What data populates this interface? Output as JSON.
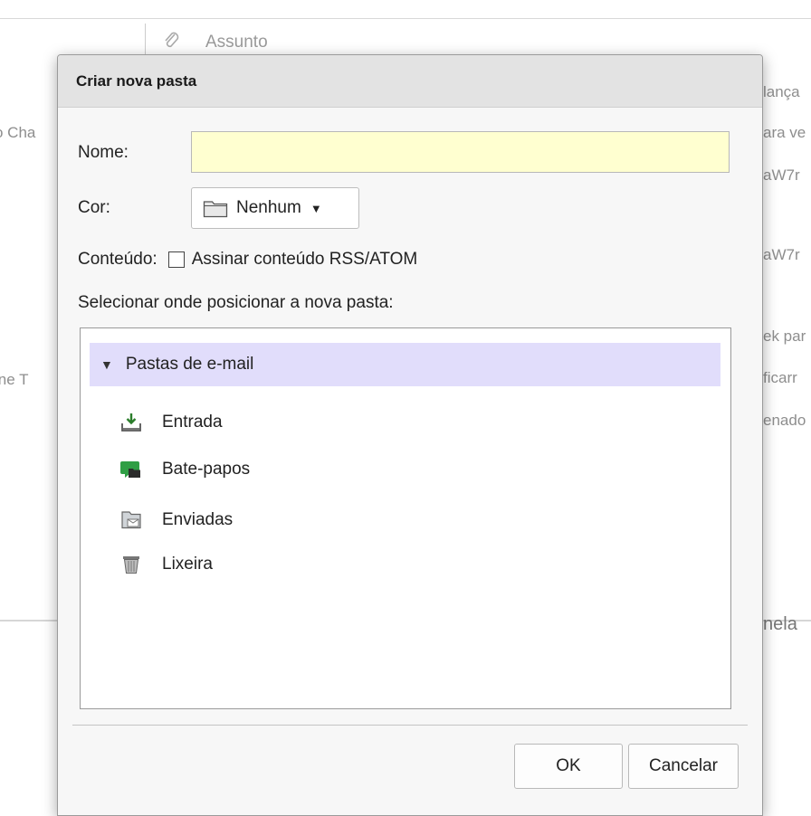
{
  "background": {
    "subject_header": "Assunto",
    "left_fragments": [
      "o Cha",
      "ine T"
    ],
    "right_fragments": [
      "lança",
      "ara ve",
      "aW7r",
      "aW7r",
      "ek par",
      "ficarr",
      "enado",
      "nela"
    ]
  },
  "dialog": {
    "title": "Criar nova pasta",
    "name_label": "Nome:",
    "name_value": "",
    "color_label": "Cor:",
    "color_value": "Nenhum",
    "content_label": "Conteúdo:",
    "rss_checkbox_label": "Assinar conteúdo RSS/ATOM",
    "rss_checked": false,
    "location_label": "Selecionar onde posicionar a nova pasta:",
    "tree": {
      "root": "Pastas de e-mail",
      "items": [
        {
          "label": "Entrada",
          "icon": "inbox-icon"
        },
        {
          "label": "Bate-papos",
          "icon": "chat-icon"
        },
        {
          "label": "Enviadas",
          "icon": "sent-icon"
        },
        {
          "label": "Lixeira",
          "icon": "trash-icon"
        }
      ]
    },
    "ok_label": "OK",
    "cancel_label": "Cancelar"
  },
  "colors": {
    "selection": "#e1ddfb",
    "name_field": "#ffffd0",
    "chat_green": "#2f9e44"
  }
}
